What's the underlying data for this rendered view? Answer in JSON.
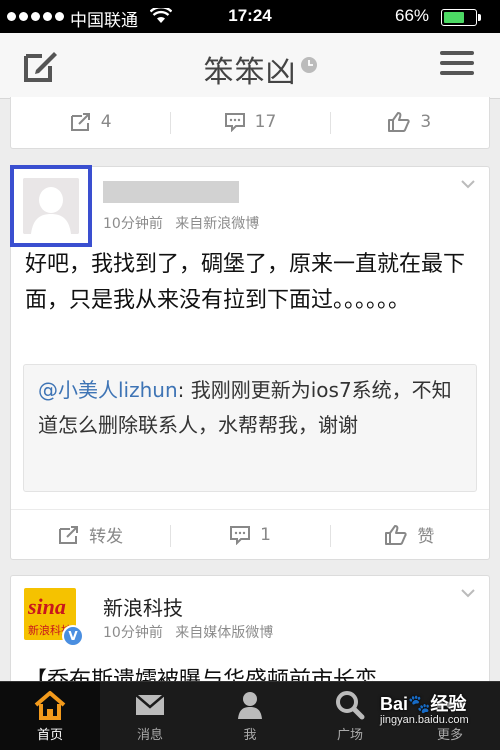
{
  "status_bar": {
    "carrier": "中国联通",
    "time": "17:24",
    "battery": "66%",
    "battery_level": 0.66
  },
  "nav": {
    "title": "笨笨凶"
  },
  "top_card": {
    "repost_count": "4",
    "comment_count": "17",
    "like_count": "3"
  },
  "post": {
    "name_mark": "ノ",
    "time": "10分钟前",
    "source": "来自新浪微博",
    "text": "好吧，我找到了，碉堡了，原来一直就在最下面，只是我从来没有拉到下面过。。。。。。",
    "quote_mention": "@小美人lizhun",
    "quote_text": ": 我刚刚更新为ios7系统，不知道怎么删除联系人，水帮帮我，谢谢",
    "repost_label": "转发",
    "comment_count": "1",
    "like_label": "赞"
  },
  "third_post": {
    "logo_text": "sina",
    "logo_sub": "新浪科技",
    "verified_mark": "V",
    "name": "新浪科技",
    "time": "10分钟前",
    "source": "来自媒体版微博",
    "text": "【乔布斯遗孀被曝与华盛顿前市长恋"
  },
  "tabs": [
    {
      "label": "首页",
      "icon": "home-icon",
      "active": true
    },
    {
      "label": "消息",
      "icon": "mail-icon",
      "active": false
    },
    {
      "label": "我",
      "icon": "person-icon",
      "active": false
    },
    {
      "label": "广场",
      "icon": "search-icon",
      "active": false
    },
    {
      "label": "更多",
      "icon": "more-icon",
      "active": false
    }
  ],
  "watermark": {
    "brand": "Bai🐾经验",
    "url": "jingyan.baidu.com"
  }
}
